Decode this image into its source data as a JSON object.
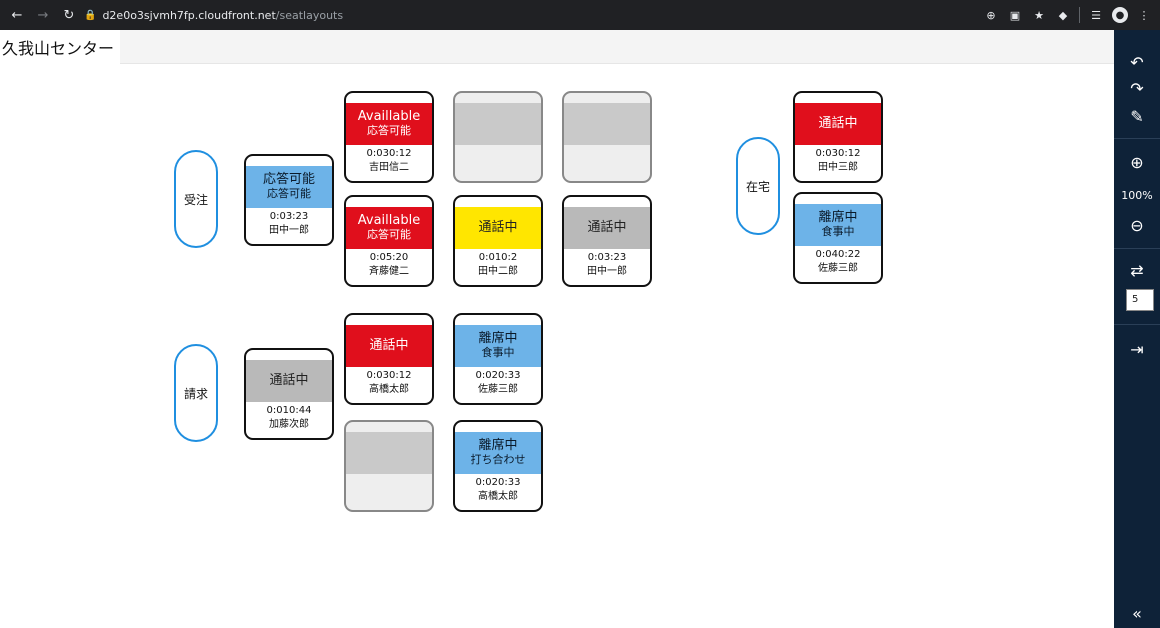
{
  "browser": {
    "url_host": "d2e0o3sjvmh7fp.cloudfront.net",
    "url_path": "/seatlayouts"
  },
  "header": {
    "center_name": "久我山センター"
  },
  "groups": [
    {
      "label": "受注"
    },
    {
      "label": "請求"
    },
    {
      "label": "在宅"
    }
  ],
  "seats": [
    {
      "line1": "応答可能",
      "line2": "応答可能",
      "time": "0:03:23",
      "name": "田中一郎",
      "color": "#6db3e8"
    },
    {
      "line1": "Availlable",
      "line2": "応答可能",
      "time": "0:030:12",
      "name": "吉田信二",
      "color": "#e00f1c"
    },
    {
      "line1": "Availlable",
      "line2": "応答可能",
      "time": "0:05:20",
      "name": "斉藤健二",
      "color": "#e00f1c"
    },
    {
      "line1": "通話中",
      "line2": "",
      "time": "0:010:2",
      "name": "田中二郎",
      "color": "#ffe600"
    },
    {
      "line1": "通話中",
      "line2": "",
      "time": "0:03:23",
      "name": "田中一郎",
      "color": "#b9b9b9"
    },
    {
      "line1": "通話中",
      "line2": "",
      "time": "0:010:44",
      "name": "加藤次郎",
      "color": "#b9b9b9"
    },
    {
      "line1": "通話中",
      "line2": "",
      "time": "0:030:12",
      "name": "高橋太郎",
      "color": "#e00f1c"
    },
    {
      "line1": "離席中",
      "line2": "食事中",
      "time": "0:020:33",
      "name": "佐藤三郎",
      "color": "#6db3e8"
    },
    {
      "line1": "離席中",
      "line2": "打ち合わせ",
      "time": "0:020:33",
      "name": "高橋太郎",
      "color": "#6db3e8"
    },
    {
      "line1": "通話中",
      "line2": "",
      "time": "0:030:12",
      "name": "田中三郎",
      "color": "#e00f1c"
    },
    {
      "line1": "離席中",
      "line2": "食事中",
      "time": "0:040:22",
      "name": "佐藤三郎",
      "color": "#6db3e8"
    }
  ],
  "sidebar": {
    "zoom": "100%",
    "input_value": "5"
  }
}
